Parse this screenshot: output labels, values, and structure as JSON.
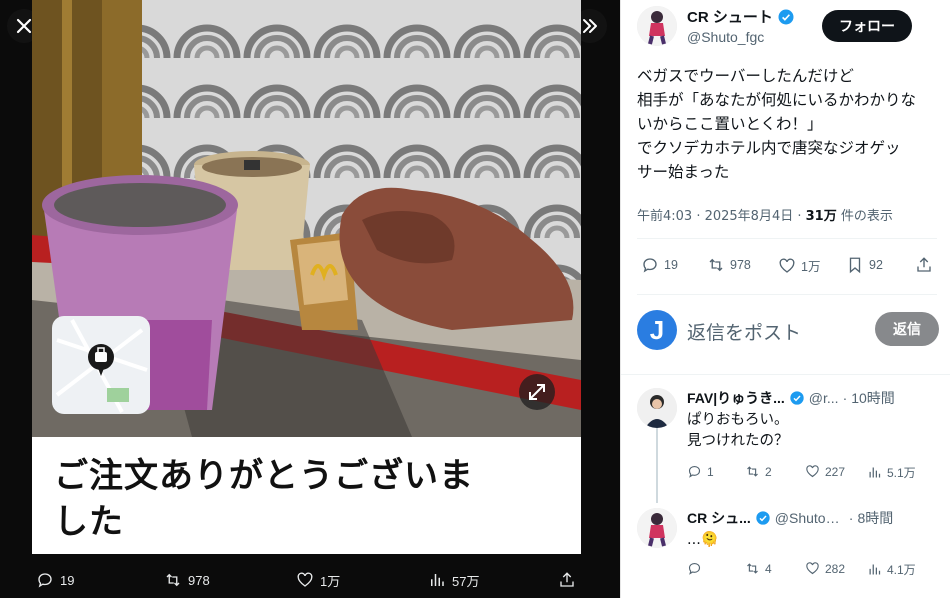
{
  "media": {
    "order_card_title_line1": "ご注文ありがとうございま",
    "order_card_title_line2": "した",
    "actions": {
      "replies": "19",
      "reposts": "978",
      "likes": "1万",
      "views": "57万"
    }
  },
  "author": {
    "name": "CR シュート",
    "handle": "@Shuto_fgc",
    "follow_label": "フォロー"
  },
  "tweet": {
    "lines": [
      "ベガスでウーバーしたんだけど",
      "相手が「あなたが何処にいるかわかりな",
      "いからここ置いとくわ！」",
      "でクソデカホテル内で唐突なジオゲッ",
      "サー始まった"
    ],
    "time": "午前4:03 · 2025年8月4日 · ",
    "views_count": "31万",
    "views_label": " 件の表示",
    "actions": {
      "replies": "19",
      "reposts": "978",
      "likes": "1万",
      "bookmarks": "92"
    }
  },
  "reply_box": {
    "avatar_letter": "J",
    "placeholder": "返信をポスト",
    "button": "返信"
  },
  "replies": [
    {
      "name": "FAV|りゅうき...",
      "handle": "@r...",
      "time": "10時間",
      "text_line1": "ぱりおもろい。",
      "text_line2": "見つけれたの？",
      "replies": "1",
      "reposts": "2",
      "likes": "227",
      "views": "5.1万"
    },
    {
      "name": "CR シュ...",
      "handle": "@Shuto_...",
      "time": "8時間",
      "text_line1": "...🫠",
      "replies": "",
      "reposts": "4",
      "likes": "282",
      "views": "4.1万"
    }
  ],
  "colors": {
    "verified": "#1d9bf0",
    "follow_bg": "#0f1419",
    "reply_avatar": "#2a7de1"
  }
}
